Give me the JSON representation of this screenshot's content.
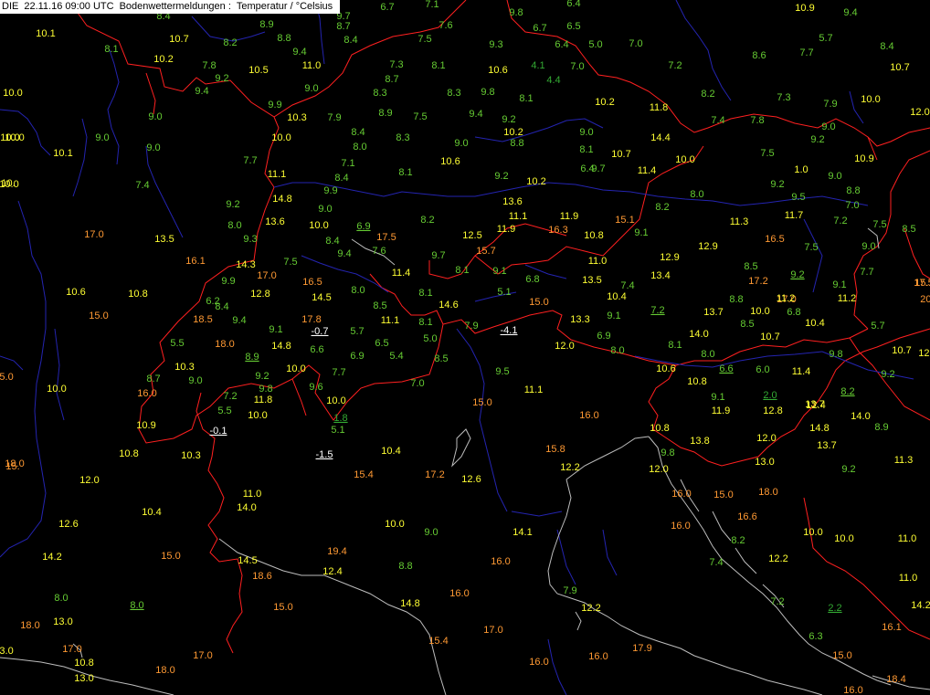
{
  "header": {
    "source": "DIE",
    "datetime": "22.11.16 09:00 UTC",
    "product": "Bodenwettermeldungen :",
    "parameter": "Temperatur / °Celsius"
  },
  "colors": {
    "background": "#000000",
    "temp_below_5": "#ffffff",
    "temp_5_10": "#66cc33",
    "temp_10_15": "#ffff33",
    "temp_15_plus": "#ff9933",
    "low_value": "#33aa33",
    "country_border": "#ff2020",
    "river": "#2020c0",
    "coastline": "#c0c0c0"
  },
  "observations": [
    {
      "v": "8.4",
      "c": "g"
    },
    {
      "v": "9.7",
      "c": "g"
    },
    {
      "v": "6.7",
      "c": "g"
    },
    {
      "v": "7.1",
      "c": "g"
    },
    {
      "v": "9.8",
      "c": "g"
    },
    {
      "v": "6.4",
      "c": "g"
    },
    {
      "v": "10.9",
      "c": "y"
    },
    {
      "v": "9.4",
      "c": "g"
    },
    {
      "v": "10.1",
      "c": "y"
    },
    {
      "v": "8.9",
      "c": "g"
    },
    {
      "v": "8.7",
      "c": "g"
    },
    {
      "v": "7.6",
      "c": "g"
    },
    {
      "v": "6.7",
      "c": "g"
    },
    {
      "v": "6.5",
      "c": "g"
    },
    {
      "v": "10.7",
      "c": "y"
    },
    {
      "v": "8.2",
      "c": "g"
    },
    {
      "v": "8.8",
      "c": "g"
    },
    {
      "v": "8.4",
      "c": "g"
    },
    {
      "v": "7.5",
      "c": "g"
    },
    {
      "v": "9.3",
      "c": "g"
    },
    {
      "v": "6.4",
      "c": "g"
    },
    {
      "v": "5.0",
      "c": "g"
    },
    {
      "v": "7.0",
      "c": "g"
    },
    {
      "v": "5.7",
      "c": "g"
    },
    {
      "v": "8.4",
      "c": "g"
    },
    {
      "v": "8.1",
      "c": "g"
    },
    {
      "v": "9.4",
      "c": "g"
    },
    {
      "v": "10.2",
      "c": "y"
    },
    {
      "v": "8.6",
      "c": "g"
    },
    {
      "v": "7.7",
      "c": "g"
    },
    {
      "v": "7.8",
      "c": "g"
    },
    {
      "v": "10.5",
      "c": "y"
    },
    {
      "v": "11.0",
      "c": "y"
    },
    {
      "v": "7.3",
      "c": "g"
    },
    {
      "v": "8.1",
      "c": "g"
    },
    {
      "v": "10.6",
      "c": "y"
    },
    {
      "v": "4.1",
      "c": "d"
    },
    {
      "v": "7.0",
      "c": "g"
    },
    {
      "v": "7.2",
      "c": "g"
    },
    {
      "v": "10.7",
      "c": "y"
    },
    {
      "v": "9.2",
      "c": "g"
    },
    {
      "v": "8.7",
      "c": "g"
    },
    {
      "v": "4.4",
      "c": "d"
    },
    {
      "v": "10.0",
      "c": "y"
    },
    {
      "v": "9.4",
      "c": "g"
    },
    {
      "v": "9.0",
      "c": "g"
    },
    {
      "v": "8.3",
      "c": "g"
    },
    {
      "v": "8.3",
      "c": "g"
    },
    {
      "v": "9.8",
      "c": "g"
    },
    {
      "v": "8.1",
      "c": "g"
    },
    {
      "v": "10.2",
      "c": "y"
    },
    {
      "v": "8.2",
      "c": "g"
    },
    {
      "v": "7.3",
      "c": "g"
    },
    {
      "v": "7.9",
      "c": "g"
    },
    {
      "v": "10.0",
      "c": "y"
    },
    {
      "v": "9.0",
      "c": "g"
    },
    {
      "v": "9.9",
      "c": "g"
    },
    {
      "v": "11.8",
      "c": "y"
    },
    {
      "v": "12.0",
      "c": "y"
    },
    {
      "v": "9.0",
      "c": "g"
    },
    {
      "v": "10.3",
      "c": "y"
    },
    {
      "v": "7.9",
      "c": "g"
    },
    {
      "v": "8.9",
      "c": "g"
    },
    {
      "v": "7.5",
      "c": "g"
    },
    {
      "v": "9.4",
      "c": "g"
    },
    {
      "v": "9.2",
      "c": "g"
    },
    {
      "v": "7.4",
      "c": "g"
    },
    {
      "v": "7.8",
      "c": "g"
    },
    {
      "v": "9.0",
      "c": "g"
    },
    {
      "v": "10.0",
      "c": "y"
    },
    {
      "v": "9.0",
      "c": "g"
    },
    {
      "v": "10.0",
      "c": "y"
    },
    {
      "v": "8.4",
      "c": "g"
    },
    {
      "v": "8.3",
      "c": "g"
    },
    {
      "v": "10.2",
      "c": "y"
    },
    {
      "v": "9.0",
      "c": "g"
    },
    {
      "v": "14.4",
      "c": "y"
    },
    {
      "v": "9.2",
      "c": "g"
    },
    {
      "v": "10.1",
      "c": "y"
    },
    {
      "v": "10.0",
      "c": "y"
    },
    {
      "v": "8.0",
      "c": "g"
    },
    {
      "v": "8.8",
      "c": "g"
    },
    {
      "v": "9.0",
      "c": "g"
    },
    {
      "v": "8.1",
      "c": "g"
    },
    {
      "v": "10.7",
      "c": "y"
    },
    {
      "v": "10.0",
      "c": "y"
    },
    {
      "v": "7.5",
      "c": "g"
    },
    {
      "v": "10.9",
      "c": "y"
    },
    {
      "v": "10.0",
      "c": "y"
    },
    {
      "v": "7.4",
      "c": "g"
    },
    {
      "v": "7.7",
      "c": "g"
    },
    {
      "v": "7.1",
      "c": "g"
    },
    {
      "v": "10.6",
      "c": "y"
    },
    {
      "v": "6.4",
      "c": "g"
    },
    {
      "v": "9.7",
      "c": "g"
    },
    {
      "v": "11.4",
      "c": "y"
    },
    {
      "v": "1.0",
      "c": "y"
    },
    {
      "v": "9.0",
      "c": "g"
    },
    {
      "v": "11.1",
      "c": "y"
    },
    {
      "v": "8.4",
      "c": "g"
    },
    {
      "v": "8.1",
      "c": "g"
    },
    {
      "v": "9.2",
      "c": "g"
    },
    {
      "v": "10.2",
      "c": "y"
    },
    {
      "v": "8.8",
      "c": "g"
    },
    {
      "v": "14.8",
      "c": "y"
    },
    {
      "v": "13.6",
      "c": "y"
    },
    {
      "v": "8.2",
      "c": "g"
    },
    {
      "v": "8.0",
      "c": "g"
    },
    {
      "v": "9.2",
      "c": "g"
    },
    {
      "v": "7.0",
      "c": "g"
    },
    {
      "v": "9.2",
      "c": "g"
    },
    {
      "v": "9.0",
      "c": "g"
    },
    {
      "v": "9.9",
      "c": "g"
    },
    {
      "v": "11.1",
      "c": "y"
    },
    {
      "v": "11.9",
      "c": "y"
    },
    {
      "v": "9.5",
      "c": "g"
    },
    {
      "v": "13.6",
      "c": "y"
    },
    {
      "v": "10.0",
      "c": "y"
    },
    {
      "v": "6.9",
      "c": "g",
      "u": 1
    },
    {
      "v": "8.2",
      "c": "g"
    },
    {
      "v": "11.9",
      "c": "y"
    },
    {
      "v": "16.3",
      "c": "o"
    },
    {
      "v": "15.1",
      "c": "o"
    },
    {
      "v": "11.3",
      "c": "y"
    },
    {
      "v": "7.2",
      "c": "g"
    },
    {
      "v": "7.5",
      "c": "g"
    },
    {
      "v": "8.0",
      "c": "g"
    },
    {
      "v": "12.5",
      "c": "y"
    },
    {
      "v": "10.8",
      "c": "y"
    },
    {
      "v": "9.1",
      "c": "g"
    },
    {
      "v": "11.7",
      "c": "y"
    },
    {
      "v": "17.0",
      "c": "o"
    },
    {
      "v": "13.5",
      "c": "y"
    },
    {
      "v": "9.3",
      "c": "g"
    },
    {
      "v": "8.4",
      "c": "g"
    },
    {
      "v": "17.5",
      "c": "o"
    },
    {
      "v": "15.7",
      "c": "o"
    },
    {
      "v": "16.5",
      "c": "o"
    },
    {
      "v": "7.5",
      "c": "g"
    },
    {
      "v": "9.0",
      "c": "g"
    },
    {
      "v": "9.4",
      "c": "g"
    },
    {
      "v": "7.6",
      "c": "g"
    },
    {
      "v": "9.7",
      "c": "g"
    },
    {
      "v": "12.9",
      "c": "y"
    },
    {
      "v": "12.9",
      "c": "y"
    },
    {
      "v": "16.1",
      "c": "o"
    },
    {
      "v": "14.3",
      "c": "y"
    },
    {
      "v": "7.5",
      "c": "g"
    },
    {
      "v": "11.0",
      "c": "y"
    },
    {
      "v": "8.5",
      "c": "g"
    },
    {
      "v": "17.0",
      "c": "o"
    },
    {
      "v": "11.4",
      "c": "y"
    },
    {
      "v": "8.1",
      "c": "g"
    },
    {
      "v": "9.1",
      "c": "g"
    },
    {
      "v": "6.8",
      "c": "g"
    },
    {
      "v": "13.4",
      "c": "y"
    },
    {
      "v": "9.2",
      "c": "g",
      "u": 1
    },
    {
      "v": "7.7",
      "c": "g"
    },
    {
      "v": "9.9",
      "c": "g"
    },
    {
      "v": "16.5",
      "c": "o"
    },
    {
      "v": "13.5",
      "c": "y"
    },
    {
      "v": "17.2",
      "c": "o"
    },
    {
      "v": "10.6",
      "c": "y"
    },
    {
      "v": "10.8",
      "c": "y"
    },
    {
      "v": "12.8",
      "c": "y"
    },
    {
      "v": "8.0",
      "c": "g"
    },
    {
      "v": "8.1",
      "c": "g"
    },
    {
      "v": "5.1",
      "c": "g"
    },
    {
      "v": "7.4",
      "c": "g"
    },
    {
      "v": "9.1",
      "c": "g"
    },
    {
      "v": "8.8",
      "c": "g"
    },
    {
      "v": "6.2",
      "c": "g"
    },
    {
      "v": "14.5",
      "c": "y"
    },
    {
      "v": "10.4",
      "c": "y"
    },
    {
      "v": "17.0",
      "c": "o"
    },
    {
      "v": "11.2",
      "c": "y"
    },
    {
      "v": "11.2",
      "c": "y"
    },
    {
      "v": "15.0",
      "c": "o"
    },
    {
      "v": "8.4",
      "c": "g"
    },
    {
      "v": "8.5",
      "c": "g"
    },
    {
      "v": "14.6",
      "c": "y"
    },
    {
      "v": "15.0",
      "c": "o"
    },
    {
      "v": "7.2",
      "c": "g",
      "u": 1
    },
    {
      "v": "13.7",
      "c": "y"
    },
    {
      "v": "10.0",
      "c": "y"
    },
    {
      "v": "6.8",
      "c": "g"
    },
    {
      "v": "18.5",
      "c": "o"
    },
    {
      "v": "9.4",
      "c": "g"
    },
    {
      "v": "17.8",
      "c": "o"
    },
    {
      "v": "11.1",
      "c": "y"
    },
    {
      "v": "8.1",
      "c": "g"
    },
    {
      "v": "7.9",
      "c": "g"
    },
    {
      "v": "13.3",
      "c": "y"
    },
    {
      "v": "9.1",
      "c": "g"
    },
    {
      "v": "8.5",
      "c": "g"
    },
    {
      "v": "10.4",
      "c": "y"
    },
    {
      "v": "5.7",
      "c": "g"
    },
    {
      "v": "9.1",
      "c": "g"
    },
    {
      "v": "-0.7",
      "c": "w",
      "u": 1
    },
    {
      "v": "5.7",
      "c": "g"
    },
    {
      "v": "-4.1",
      "c": "w",
      "u": 1
    },
    {
      "v": "6.9",
      "c": "g"
    },
    {
      "v": "14.0",
      "c": "y"
    },
    {
      "v": "10.7",
      "c": "y"
    },
    {
      "v": "5.5",
      "c": "g"
    },
    {
      "v": "18.0",
      "c": "o"
    },
    {
      "v": "14.8",
      "c": "y"
    },
    {
      "v": "6.6",
      "c": "g"
    },
    {
      "v": "6.5",
      "c": "g"
    },
    {
      "v": "5.0",
      "c": "g"
    },
    {
      "v": "12.0",
      "c": "y"
    },
    {
      "v": "8.0",
      "c": "g"
    },
    {
      "v": "8.1",
      "c": "g"
    },
    {
      "v": "9.8",
      "c": "g"
    },
    {
      "v": "10.7",
      "c": "y"
    },
    {
      "v": "8.9",
      "c": "g",
      "u": 1
    },
    {
      "v": "6.9",
      "c": "g"
    },
    {
      "v": "5.4",
      "c": "g"
    },
    {
      "v": "8.5",
      "c": "g"
    },
    {
      "v": "8.0",
      "c": "g"
    },
    {
      "v": "10.3",
      "c": "y"
    },
    {
      "v": "10.0",
      "c": "y"
    },
    {
      "v": "7.7",
      "c": "g"
    },
    {
      "v": "9.5",
      "c": "g"
    },
    {
      "v": "10.6",
      "c": "y"
    },
    {
      "v": "6.6",
      "c": "g",
      "u": 1
    },
    {
      "v": "6.0",
      "c": "g"
    },
    {
      "v": "11.4",
      "c": "y"
    },
    {
      "v": "9.2",
      "c": "g"
    },
    {
      "v": "8.7",
      "c": "g"
    },
    {
      "v": "9.0",
      "c": "g"
    },
    {
      "v": "9.2",
      "c": "g"
    },
    {
      "v": "7.0",
      "c": "g"
    },
    {
      "v": "10.8",
      "c": "y"
    },
    {
      "v": "16.0",
      "c": "o"
    },
    {
      "v": "9.8",
      "c": "g"
    },
    {
      "v": "9.6",
      "c": "g"
    },
    {
      "v": "11.1",
      "c": "y"
    },
    {
      "v": "8.2",
      "c": "g",
      "u": 1
    },
    {
      "v": "7.2",
      "c": "g"
    },
    {
      "v": "11.8",
      "c": "y"
    },
    {
      "v": "10.0",
      "c": "y"
    },
    {
      "v": "15.0",
      "c": "o"
    },
    {
      "v": "9.1",
      "c": "g"
    },
    {
      "v": "2.0",
      "c": "d",
      "u": 1
    },
    {
      "v": "13.7",
      "c": "y"
    },
    {
      "v": "14.0",
      "c": "y"
    },
    {
      "v": "5.5",
      "c": "g"
    },
    {
      "v": "10.0",
      "c": "y"
    },
    {
      "v": "1.8",
      "c": "d",
      "u": 1
    },
    {
      "v": "16.0",
      "c": "o"
    },
    {
      "v": "11.9",
      "c": "y"
    },
    {
      "v": "12.8",
      "c": "y"
    },
    {
      "v": "10.9",
      "c": "y"
    },
    {
      "v": "-0.1",
      "c": "w",
      "u": 1
    },
    {
      "v": "5.1",
      "c": "g"
    },
    {
      "v": "10.8",
      "c": "y"
    },
    {
      "v": "14.8",
      "c": "y"
    },
    {
      "v": "8.9",
      "c": "g"
    },
    {
      "v": "10.8",
      "c": "y"
    },
    {
      "v": "10.3",
      "c": "y"
    },
    {
      "v": "-1.5",
      "c": "w",
      "u": 1
    },
    {
      "v": "10.4",
      "c": "y"
    },
    {
      "v": "15.8",
      "c": "o"
    },
    {
      "v": "9.8",
      "c": "g"
    },
    {
      "v": "13.8",
      "c": "y"
    },
    {
      "v": "12.0",
      "c": "y"
    },
    {
      "v": "13.7",
      "c": "y"
    },
    {
      "v": "11.3",
      "c": "y"
    },
    {
      "v": "12.0",
      "c": "y"
    },
    {
      "v": "15.4",
      "c": "o"
    },
    {
      "v": "17.2",
      "c": "o"
    },
    {
      "v": "12.6",
      "c": "y"
    },
    {
      "v": "12.2",
      "c": "y"
    },
    {
      "v": "12.0",
      "c": "y"
    },
    {
      "v": "13.0",
      "c": "y"
    },
    {
      "v": "9.2",
      "c": "g"
    },
    {
      "v": "11.0",
      "c": "y"
    },
    {
      "v": "14.0",
      "c": "y"
    },
    {
      "v": "16.0",
      "c": "o"
    },
    {
      "v": "15.0",
      "c": "o"
    },
    {
      "v": "18.0",
      "c": "o"
    },
    {
      "v": "10.4",
      "c": "y"
    },
    {
      "v": "12.6",
      "c": "y"
    },
    {
      "v": "10.0",
      "c": "y"
    },
    {
      "v": "9.0",
      "c": "g"
    },
    {
      "v": "14.1",
      "c": "y"
    },
    {
      "v": "16.0",
      "c": "o"
    },
    {
      "v": "16.6",
      "c": "o"
    },
    {
      "v": "10.0",
      "c": "y"
    },
    {
      "v": "10.0",
      "c": "y"
    },
    {
      "v": "11.0",
      "c": "y"
    },
    {
      "v": "14.2",
      "c": "y"
    },
    {
      "v": "15.0",
      "c": "o"
    },
    {
      "v": "19.4",
      "c": "o"
    },
    {
      "v": "16.0",
      "c": "o"
    },
    {
      "v": "8.2",
      "c": "g"
    },
    {
      "v": "12.2",
      "c": "y"
    },
    {
      "v": "14.5",
      "c": "y"
    },
    {
      "v": "8.8",
      "c": "g"
    },
    {
      "v": "7.4",
      "c": "g"
    },
    {
      "v": "11.0",
      "c": "y"
    },
    {
      "v": "18.6",
      "c": "o"
    },
    {
      "v": "12.4",
      "c": "y"
    },
    {
      "v": "8.0",
      "c": "g"
    },
    {
      "v": "8.0",
      "c": "g",
      "u": 1
    },
    {
      "v": "16.0",
      "c": "o"
    },
    {
      "v": "7.9",
      "c": "g"
    },
    {
      "v": "7.2",
      "c": "g"
    },
    {
      "v": "15.0",
      "c": "o"
    },
    {
      "v": "14.8",
      "c": "y"
    },
    {
      "v": "12.2",
      "c": "y"
    },
    {
      "v": "2.2",
      "c": "d",
      "u": 1
    },
    {
      "v": "14.2",
      "c": "y"
    },
    {
      "v": "18.0",
      "c": "o"
    },
    {
      "v": "13.0",
      "c": "y"
    },
    {
      "v": "17.0",
      "c": "o"
    },
    {
      "v": "16.1",
      "c": "o"
    },
    {
      "v": "15.4",
      "c": "o"
    },
    {
      "v": "6.3",
      "c": "g"
    },
    {
      "v": "17.0",
      "c": "o"
    },
    {
      "v": "16.0",
      "c": "o"
    },
    {
      "v": "15.0",
      "c": "o"
    },
    {
      "v": "10.8",
      "c": "y"
    },
    {
      "v": "17.0",
      "c": "o"
    },
    {
      "v": "17.9",
      "c": "o"
    },
    {
      "v": "16.0",
      "c": "o"
    },
    {
      "v": "13.0",
      "c": "y"
    },
    {
      "v": "18.0",
      "c": "o"
    },
    {
      "v": "18.4",
      "c": "o"
    },
    {
      "v": "16.0",
      "c": "o"
    },
    {
      "v": "13.0",
      "c": "y"
    },
    {
      "v": "12.4",
      "c": "y"
    },
    {
      "v": "17.5",
      "c": "o"
    },
    {
      "v": "15.1",
      "c": "o"
    },
    {
      "v": "20.3",
      "c": "o"
    },
    {
      "v": "18.0",
      "c": "o"
    },
    {
      "v": "10.0",
      "c": "y"
    },
    {
      "v": "12.8",
      "c": "y"
    },
    {
      "v": "15.0",
      "c": "o"
    },
    {
      "v": "15.",
      "c": "o"
    },
    {
      "v": "10.",
      "c": "y"
    },
    {
      "v": "8.5",
      "c": "g"
    },
    {
      "v": "9.0",
      "c": "g"
    },
    {
      "v": "10.0",
      "c": "y"
    },
    {
      "v": "9.8",
      "c": "g"
    },
    {
      "v": "9.8",
      "c": "g"
    },
    {
      "v": "10.0",
      "c": "y"
    },
    {
      "v": "13.5",
      "c": "y"
    }
  ]
}
